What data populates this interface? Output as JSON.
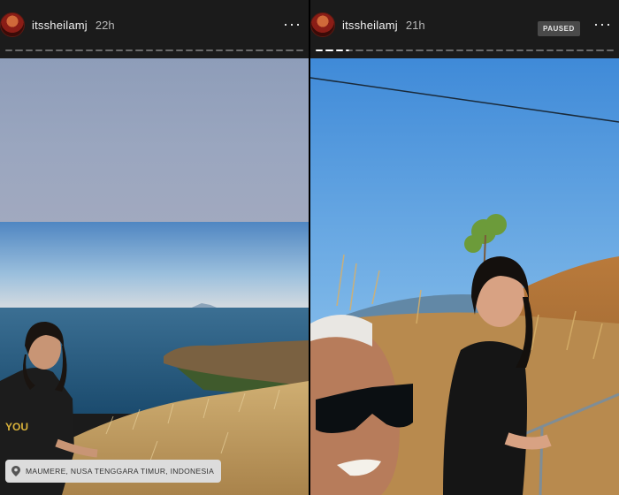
{
  "left_story": {
    "username": "itssheilamj",
    "time": "22h",
    "more_label": "···",
    "progress_segments": [
      1,
      1,
      1,
      1,
      1,
      1,
      1,
      1,
      1,
      1,
      1,
      1,
      1,
      1,
      1,
      1,
      1,
      1,
      1,
      1,
      1,
      1,
      1,
      1,
      1,
      1,
      1,
      1,
      1,
      1
    ],
    "location": "MAUMERE, NUSA TENGGARA TIMUR, INDONESIA",
    "icons": {
      "avatar": "profile-avatar",
      "more": "more-horizontal-icon",
      "pin": "location-pin-icon"
    }
  },
  "right_story": {
    "username": "itssheilamj",
    "time": "21h",
    "paused_label": "PAUSED",
    "more_label": "···",
    "icons": {
      "avatar": "profile-avatar",
      "more": "more-horizontal-icon"
    }
  },
  "colors": {
    "header_bg": "#1b1b1b",
    "progress_filled": "#ffffff",
    "progress_empty": "rgba(255,255,255,0.35)",
    "location_bg": "#dcdcdc"
  }
}
